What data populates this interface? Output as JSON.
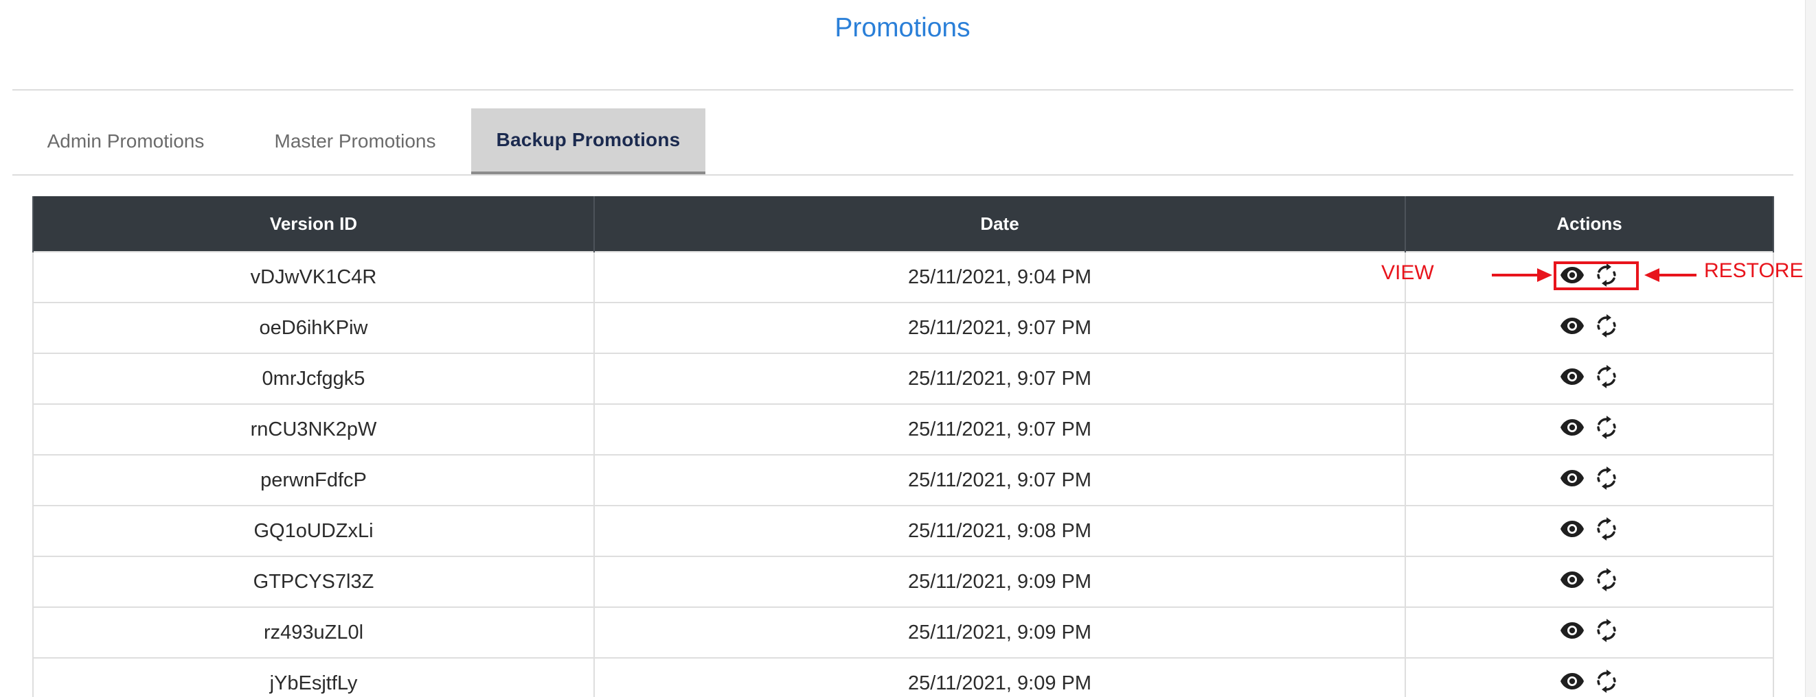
{
  "page": {
    "title": "Promotions"
  },
  "tabs": [
    {
      "label": "Admin Promotions",
      "active": false
    },
    {
      "label": "Master Promotions",
      "active": false
    },
    {
      "label": "Backup Promotions",
      "active": true
    }
  ],
  "table": {
    "columns": [
      "Version ID",
      "Date",
      "Actions"
    ],
    "rows": [
      {
        "version_id": "vDJwVK1C4R",
        "date": "25/11/2021, 9:04 PM"
      },
      {
        "version_id": "oeD6ihKPiw",
        "date": "25/11/2021, 9:07 PM"
      },
      {
        "version_id": "0mrJcfggk5",
        "date": "25/11/2021, 9:07 PM"
      },
      {
        "version_id": "rnCU3NK2pW",
        "date": "25/11/2021, 9:07 PM"
      },
      {
        "version_id": "perwnFdfcP",
        "date": "25/11/2021, 9:07 PM"
      },
      {
        "version_id": "GQ1oUDZxLi",
        "date": "25/11/2021, 9:08 PM"
      },
      {
        "version_id": "GTPCYS7l3Z",
        "date": "25/11/2021, 9:09 PM"
      },
      {
        "version_id": "rz493uZL0l",
        "date": "25/11/2021, 9:09 PM"
      },
      {
        "version_id": "jYbEsjtfLy",
        "date": "25/11/2021, 9:09 PM"
      }
    ],
    "action_icons": [
      "eye-icon",
      "refresh-icon"
    ]
  },
  "annotations": {
    "view_label": "VIEW",
    "restore_label": "RESTORE",
    "color": "#e8141c"
  },
  "colors": {
    "title": "#2a7fd8",
    "header_bg": "#343a40",
    "active_tab_bg": "#d3d3d3",
    "active_tab_text": "#1b2a4f",
    "icon": "#1f1f1f"
  }
}
